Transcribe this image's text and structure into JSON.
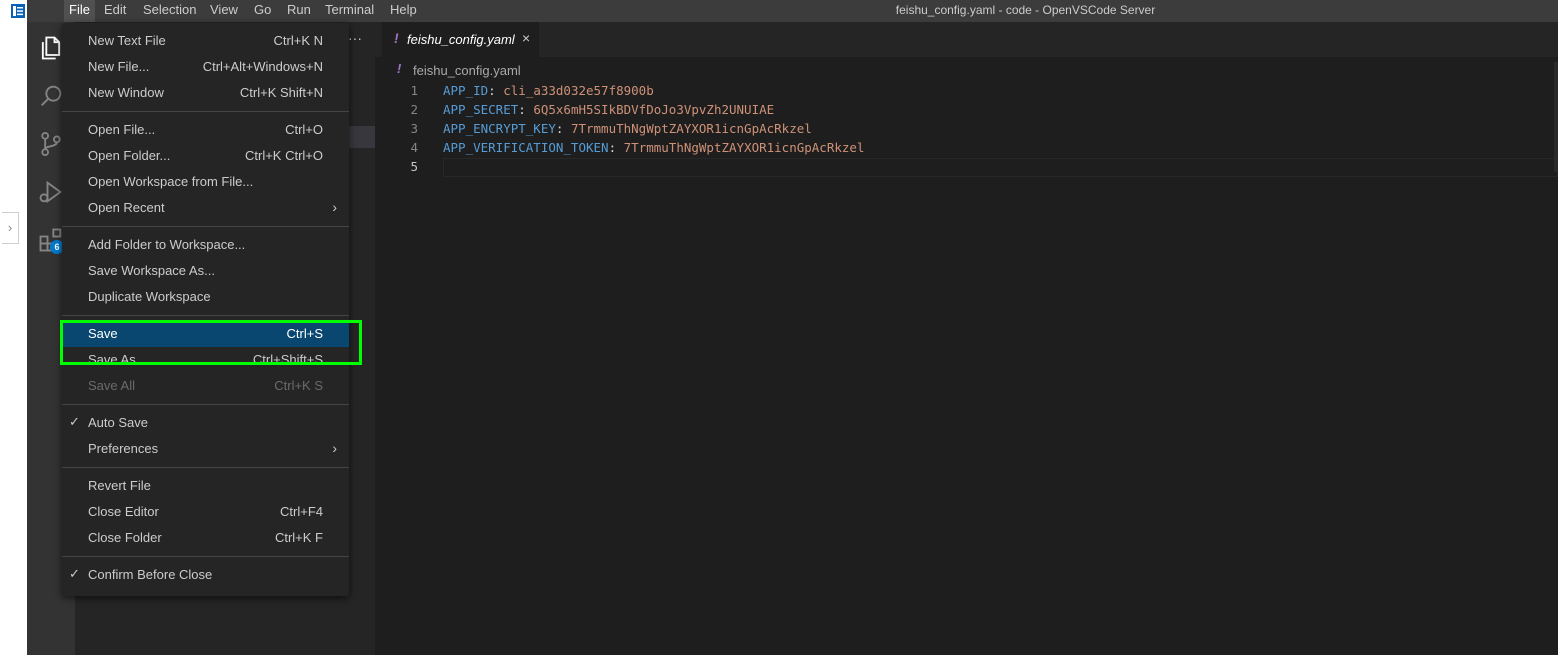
{
  "menubar": {
    "items": [
      "File",
      "Edit",
      "Selection",
      "View",
      "Go",
      "Run",
      "Terminal",
      "Help"
    ],
    "active": "File"
  },
  "window_title": "feishu_config.yaml - code - OpenVSCode Server",
  "activity_badge": "6",
  "sidebar": {
    "more": "···"
  },
  "editor": {
    "tab": {
      "label": "feishu_config.yaml",
      "modified_glyph": "!",
      "close_glyph": "×"
    },
    "breadcrumb": "feishu_config.yaml",
    "lines": [
      {
        "num": "1",
        "key": "APP_ID",
        "sep": ": ",
        "value": "cli_a33d032e57f8900b"
      },
      {
        "num": "2",
        "key": "APP_SECRET",
        "sep": ": ",
        "value": "6Q5x6mH5SIkBDVfDoJo3VpvZh2UNUIAE"
      },
      {
        "num": "3",
        "key": "APP_ENCRYPT_KEY",
        "sep": ": ",
        "value": "7TrmmuThNgWptZAYXOR1icnGpAcRkzel"
      },
      {
        "num": "4",
        "key": "APP_VERIFICATION_TOKEN",
        "sep": ": ",
        "value": "7TrmmuThNgWptZAYXOR1icnGpAcRkzel"
      },
      {
        "num": "5",
        "key": "",
        "sep": "",
        "value": ""
      }
    ]
  },
  "file_menu": {
    "new_text_file": {
      "label": "New Text File",
      "shortcut": "Ctrl+K N"
    },
    "new_file": {
      "label": "New File...",
      "shortcut": "Ctrl+Alt+Windows+N"
    },
    "new_window": {
      "label": "New Window",
      "shortcut": "Ctrl+K Shift+N"
    },
    "open_file": {
      "label": "Open File...",
      "shortcut": "Ctrl+O"
    },
    "open_folder": {
      "label": "Open Folder...",
      "shortcut": "Ctrl+K Ctrl+O"
    },
    "open_workspace": {
      "label": "Open Workspace from File..."
    },
    "open_recent": {
      "label": "Open Recent"
    },
    "add_folder": {
      "label": "Add Folder to Workspace..."
    },
    "save_workspace_as": {
      "label": "Save Workspace As..."
    },
    "duplicate_workspace": {
      "label": "Duplicate Workspace"
    },
    "save": {
      "label": "Save",
      "shortcut": "Ctrl+S"
    },
    "save_as": {
      "label": "Save As...",
      "shortcut": "Ctrl+Shift+S"
    },
    "save_all": {
      "label": "Save All",
      "shortcut": "Ctrl+K S"
    },
    "auto_save": {
      "label": "Auto Save",
      "checked": true
    },
    "preferences": {
      "label": "Preferences"
    },
    "revert_file": {
      "label": "Revert File"
    },
    "close_editor": {
      "label": "Close Editor",
      "shortcut": "Ctrl+F4"
    },
    "close_folder": {
      "label": "Close Folder",
      "shortcut": "Ctrl+K F"
    },
    "confirm_before_close": {
      "label": "Confirm Before Close",
      "checked": true
    }
  },
  "glyphs": {
    "check": "✓",
    "submenu": "›"
  },
  "colors": {
    "highlight_box": "#00ff00",
    "menu_selection": "#094771",
    "yaml_key": "#569cd6",
    "yaml_value": "#ce9178",
    "badge": "#007acc"
  }
}
